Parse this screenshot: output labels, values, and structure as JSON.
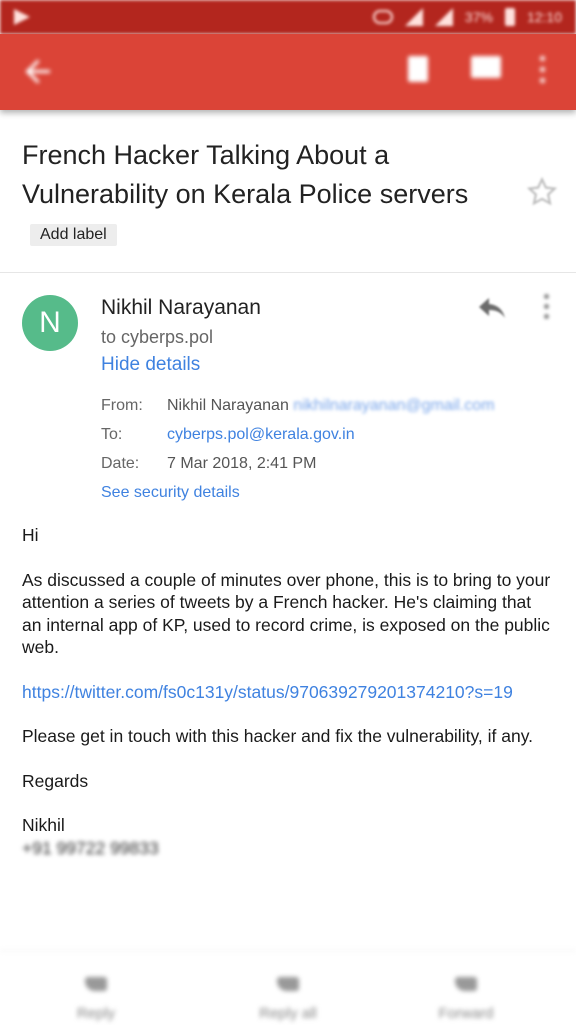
{
  "status_bar": {
    "battery": "37%",
    "time": "12:10"
  },
  "email": {
    "subject_main": "French Hacker Talking About a Vulnerability on Kerala Police servers",
    "add_label": "Add label",
    "sender": {
      "initial": "N",
      "name": "Nikhil Narayanan",
      "to_line": "to cyberps.pol",
      "hide_details": "Hide details"
    },
    "details": {
      "from_label": "From:",
      "from_name": "Nikhil Narayanan",
      "from_email": "nikhilnarayanan@gmail.com",
      "to_label": "To:",
      "to_value": "cyberps.pol@kerala.gov.in",
      "date_label": "Date:",
      "date_value": "7 Mar 2018, 2:41 PM",
      "security": "See security details"
    },
    "body": {
      "greeting": "Hi",
      "p1": "As discussed a couple of minutes over phone, this is to bring to your attention a series of tweets by a French hacker. He's claiming that an internal app of KP, used to record crime, is exposed on the public web.",
      "link": "https://twitter.com/fs0c131y/status/970639279201374210?s=19",
      "p2": "Please get in touch with this hacker and fix the vulnerability, if any.",
      "regards": "Regards",
      "signature": "Nikhil",
      "phone": "+91 99722 99833"
    }
  },
  "bottom_actions": {
    "reply": "Reply",
    "reply_all": "Reply all",
    "forward": "Forward"
  },
  "colors": {
    "app_bar": "#db4437",
    "avatar": "#56bb8a",
    "link": "#3f82e0"
  }
}
